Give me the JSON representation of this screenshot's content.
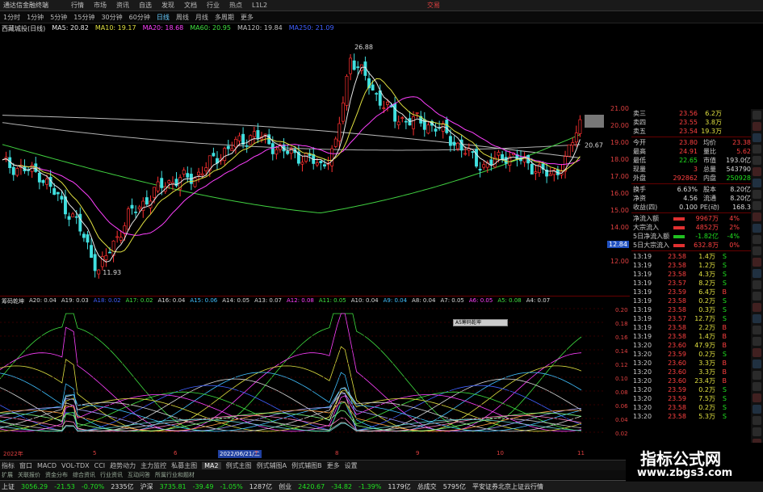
{
  "app": {
    "title": "通达信金融终端",
    "menus": [
      "行情",
      "市场",
      "资讯",
      "自选",
      "发现",
      "文档",
      "行业",
      "热点",
      "L1L2"
    ],
    "trade_label": "交易"
  },
  "periods": [
    "1分时",
    "1分钟",
    "5分钟",
    "15分钟",
    "30分钟",
    "60分钟",
    "日线",
    "周线",
    "月线",
    "多周期",
    "更多"
  ],
  "active_period": "日线",
  "stock_name": "西藏城投(日线)",
  "ma_legend": [
    {
      "label": "MA5: 20.82",
      "color": "#e8e8e8"
    },
    {
      "label": "MA10: 19.17",
      "color": "#e0e040"
    },
    {
      "label": "MA20: 18.68",
      "color": "#ff40ff"
    },
    {
      "label": "MA60: 20.95",
      "color": "#40e040"
    },
    {
      "label": "MA120: 19.84",
      "color": "#c0c0c0"
    },
    {
      "label": "MA250: 21.09",
      "color": "#4060ff"
    }
  ],
  "price_labels": {
    "high": "26.88",
    "low": "11.93",
    "current_box": "12.84",
    "right_label": "20.67"
  },
  "price_axis": [
    "21.00",
    "20.00",
    "19.00",
    "18.00",
    "17.00",
    "16.00",
    "15.00",
    "14.00",
    "13.00",
    "12.00"
  ],
  "indicator_name": "筹码乾坤",
  "indicator_legend": [
    {
      "label": "A20: 0.04",
      "color": "#d8d8d8"
    },
    {
      "label": "A19: 0.03",
      "color": "#d8d8d8"
    },
    {
      "label": "A18: 0.02",
      "color": "#4060ff"
    },
    {
      "label": "A17: 0.02",
      "color": "#40e040"
    },
    {
      "label": "A16: 0.04",
      "color": "#d8d8d8"
    },
    {
      "label": "A15: 0.06",
      "color": "#40c0ff"
    },
    {
      "label": "A14: 0.05",
      "color": "#d8d8d8"
    },
    {
      "label": "A13: 0.07",
      "color": "#d8d8d8"
    },
    {
      "label": "A12: 0.08",
      "color": "#ff40ff"
    },
    {
      "label": "A11: 0.05",
      "color": "#40e040"
    },
    {
      "label": "A10: 0.04",
      "color": "#d8d8d8"
    },
    {
      "label": "A9: 0.04",
      "color": "#40c0ff"
    },
    {
      "label": "A8: 0.04",
      "color": "#d8d8d8"
    },
    {
      "label": "A7: 0.05",
      "color": "#d8d8d8"
    },
    {
      "label": "A6: 0.05",
      "color": "#ff40ff"
    },
    {
      "label": "A5: 0.08",
      "color": "#40e040"
    },
    {
      "label": "A4: 0.07",
      "color": "#d8d8d8"
    }
  ],
  "indicator_axis": [
    "0.20",
    "0.18",
    "0.16",
    "0.14",
    "0.12",
    "0.10",
    "0.08",
    "0.06",
    "0.04",
    "0.02"
  ],
  "tooltip_text": "A5筹码乾坤",
  "date_axis": {
    "start": "2022年",
    "highlight": "2022/06/21/二",
    "marks": [
      "5",
      "6",
      "7",
      "8",
      "9",
      "10",
      "11"
    ]
  },
  "quote_rows": [
    {
      "label": "卖三",
      "price": "23.56",
      "vol": "6.2万",
      "cls": "up"
    },
    {
      "label": "卖四",
      "price": "23.55",
      "vol": "3.8万",
      "cls": "up"
    },
    {
      "label": "卖五",
      "price": "23.54",
      "vol": "19.3万",
      "cls": "up"
    }
  ],
  "stats_rows": [
    {
      "a": "今开",
      "b": "23.80",
      "c": "均价",
      "d": "23.38",
      "cb": "up",
      "cd": "up"
    },
    {
      "a": "最高",
      "b": "24.91",
      "c": "量比",
      "d": "5.62",
      "cb": "up",
      "cd": "up"
    },
    {
      "a": "最低",
      "b": "22.65",
      "c": "市值",
      "d": "193.0亿",
      "cb": "down",
      "cd": "white"
    },
    {
      "a": "现量",
      "b": "3",
      "c": "总量",
      "d": "543790",
      "cb": "up",
      "cd": "white"
    },
    {
      "a": "外盘",
      "b": "292862",
      "c": "内盘",
      "d": "250928",
      "cb": "up",
      "cd": "down"
    }
  ],
  "stats_rows2": [
    {
      "a": "换手",
      "b": "6.63%",
      "c": "股本",
      "d": "8.20亿",
      "cb": "white",
      "cd": "white"
    },
    {
      "a": "净资",
      "b": "4.56",
      "c": "流通",
      "d": "8.20亿",
      "cb": "white",
      "cd": "white"
    },
    {
      "a": "收益(四)",
      "b": "0.100",
      "c": "PE(动)",
      "d": "168.3",
      "cb": "white",
      "cd": "white"
    }
  ],
  "flow_rows": [
    {
      "label": "净流入额",
      "val": "9967万",
      "pct": "4%",
      "cls": "up"
    },
    {
      "label": "大宗流入",
      "val": "4852万",
      "pct": "2%",
      "cls": "up"
    },
    {
      "label": "5日净流入额",
      "val": "-1.82亿",
      "pct": "-4%",
      "cls": "down"
    },
    {
      "label": "5日大宗流入",
      "val": "632.8万",
      "pct": "0%",
      "cls": "up"
    }
  ],
  "tick_rows": [
    {
      "t": "13:19",
      "p": "23.58",
      "v": "1.4万",
      "f": "S"
    },
    {
      "t": "13:19",
      "p": "23.58",
      "v": "1.2万",
      "f": "S"
    },
    {
      "t": "13:19",
      "p": "23.58",
      "v": "4.3万",
      "f": "S"
    },
    {
      "t": "13:19",
      "p": "23.57",
      "v": "8.2万",
      "f": "S"
    },
    {
      "t": "13:19",
      "p": "23.59",
      "v": "6.4万",
      "f": "B"
    },
    {
      "t": "13:19",
      "p": "23.58",
      "v": "0.2万",
      "f": "S"
    },
    {
      "t": "13:19",
      "p": "23.58",
      "v": "0.3万",
      "f": "S"
    },
    {
      "t": "13:19",
      "p": "23.57",
      "v": "12.7万",
      "f": "S"
    },
    {
      "t": "13:19",
      "p": "23.58",
      "v": "2.2万",
      "f": "B"
    },
    {
      "t": "13:19",
      "p": "23.58",
      "v": "1.4万",
      "f": "B"
    },
    {
      "t": "13:20",
      "p": "23.60",
      "v": "47.9万",
      "f": "B"
    },
    {
      "t": "13:20",
      "p": "23.59",
      "v": "0.2万",
      "f": "S"
    },
    {
      "t": "13:20",
      "p": "23.60",
      "v": "3.3万",
      "f": "B"
    },
    {
      "t": "13:20",
      "p": "23.60",
      "v": "3.3万",
      "f": "B"
    },
    {
      "t": "13:20",
      "p": "23.60",
      "v": "23.4万",
      "f": "B"
    },
    {
      "t": "13:20",
      "p": "23.59",
      "v": "0.2万",
      "f": "S"
    },
    {
      "t": "13:20",
      "p": "23.59",
      "v": "7.5万",
      "f": "S"
    },
    {
      "t": "13:20",
      "p": "23.58",
      "v": "0.2万",
      "f": "S"
    },
    {
      "t": "13:20",
      "p": "23.58",
      "v": "5.3万",
      "f": "S"
    }
  ],
  "tabs": [
    "指标",
    "窗口",
    "MACD",
    "VOL-TDX",
    "CCI",
    "趋势动力",
    "主力监控",
    "私募主图",
    "MA2",
    "例式主图",
    "例式辅图A",
    "例式辅图B",
    "更多",
    "设置"
  ],
  "active_tab": "MA2",
  "tabs2": [
    "扩展",
    "关联报价",
    "资金分布",
    "综合资讯",
    "行业资讯",
    "互动问答",
    "所属行业和题材"
  ],
  "status": {
    "sh_label": "上证",
    "sh_val": "3056.29",
    "sh_chg": "-21.53",
    "sh_pct": "-0.70%",
    "sh_amt": "2335亿",
    "sz_label": "沪深",
    "sz_val": "3735.81",
    "sz_chg": "-39.49",
    "sz_pct": "-1.05%",
    "sz_amt": "1287亿",
    "cy_label": "创业",
    "cy_val": "2420.67",
    "cy_chg": "-34.82",
    "cy_pct": "-1.39%",
    "cy_amt": "1179亿",
    "total_label": "总成交",
    "total_val": "5795亿",
    "server": "平安证券北京上证云行情"
  },
  "watermark": {
    "title": "指标公式网",
    "url": "www.zbgs3.com"
  },
  "chart_data": {
    "type": "line",
    "title": "西藏城投(日线)",
    "series": [
      {
        "name": "MA5",
        "values": [
          20.82
        ]
      },
      {
        "name": "MA10",
        "values": [
          19.17
        ]
      },
      {
        "name": "MA20",
        "values": [
          18.68
        ]
      },
      {
        "name": "MA60",
        "values": [
          20.95
        ]
      },
      {
        "name": "MA120",
        "values": [
          19.84
        ]
      },
      {
        "name": "MA250",
        "values": [
          21.09
        ]
      }
    ],
    "ylim": [
      11.5,
      27.5
    ]
  }
}
